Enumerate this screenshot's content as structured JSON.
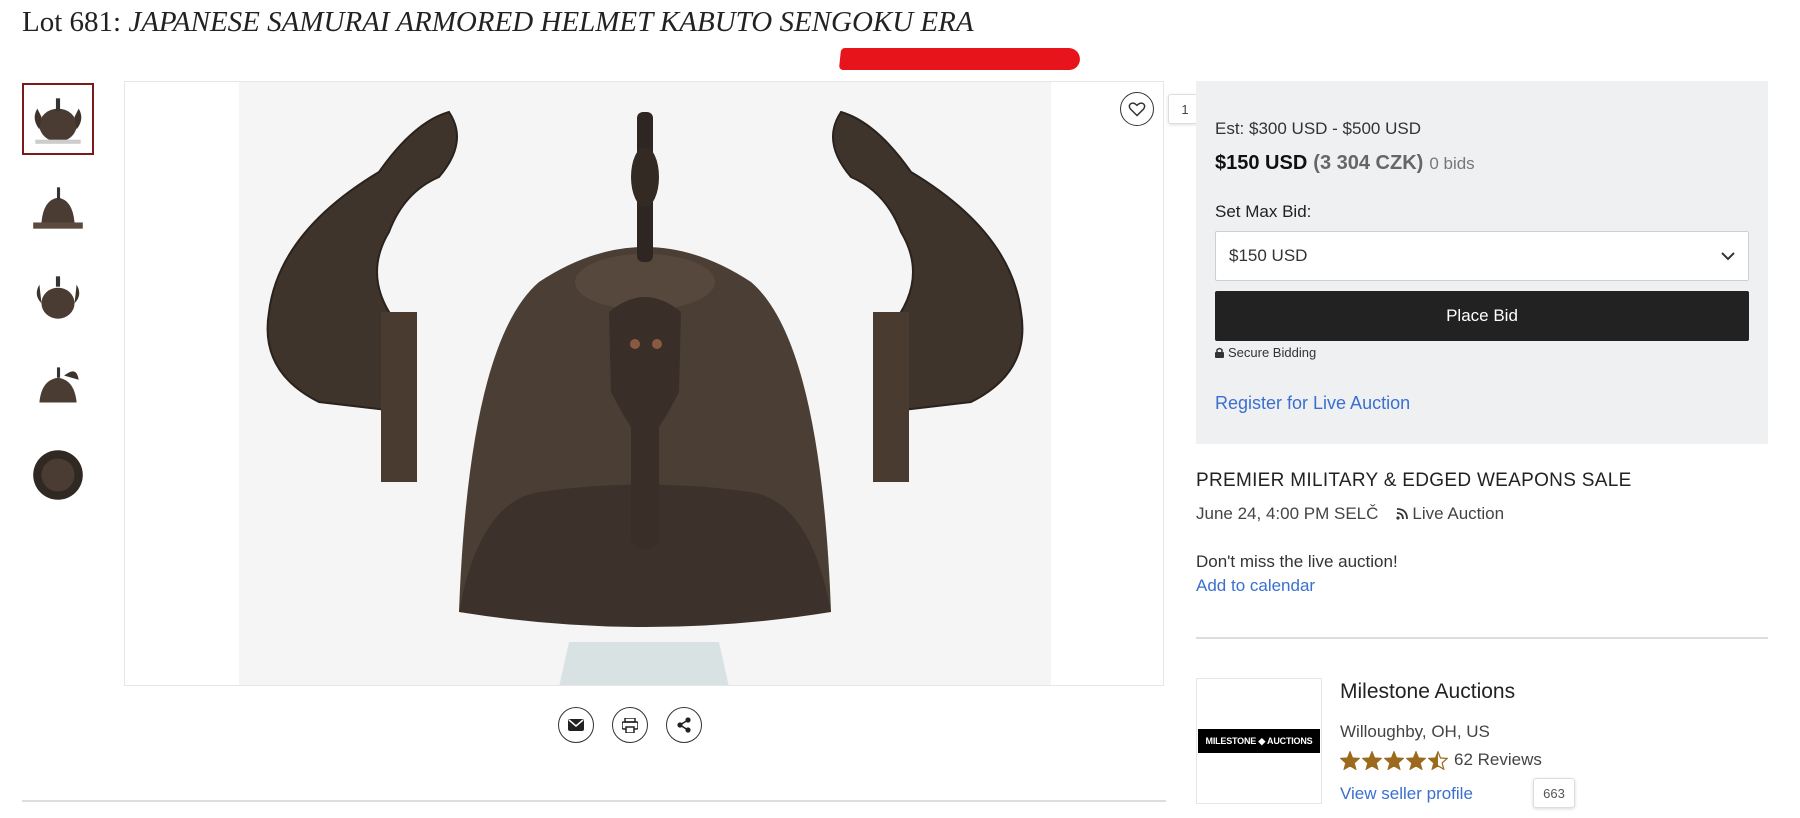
{
  "lot": {
    "prefix": "Lot 681:",
    "title": "JAPANESE SAMURAI ARMORED HELMET KABUTO SENGOKU ERA"
  },
  "thumbnails": [
    {
      "alt": "helmet-front"
    },
    {
      "alt": "helmet-side"
    },
    {
      "alt": "helmet-front-2"
    },
    {
      "alt": "helmet-side-2"
    },
    {
      "alt": "helmet-inside"
    }
  ],
  "favorite": {
    "count": "1"
  },
  "share": {
    "email": "envelope-icon",
    "print": "printer-icon",
    "share": "share-icon"
  },
  "bid": {
    "estimate": "Est: $300 USD - $500 USD",
    "current_usd": "$150 USD",
    "current_czk": "(3 304 CZK)",
    "bids": "0 bids",
    "max_bid_label": "Set Max Bid:",
    "max_bid_value": "$150 USD",
    "place_bid": "Place Bid",
    "secure": "Secure Bidding",
    "register": "Register for Live Auction"
  },
  "sale": {
    "title": "PREMIER MILITARY & EDGED WEAPONS SALE",
    "date": "June 24, 4:00 PM SELČ",
    "type": "Live Auction",
    "reminder": "Don't miss the live auction!",
    "calendar": "Add to calendar"
  },
  "seller": {
    "logo_text": "MILESTONE ◆ AUCTIONS",
    "name": "Milestone Auctions",
    "location": "Willoughby, OH, US",
    "rating": 4.5,
    "reviews": "62 Reviews",
    "profile": "View seller profile",
    "badge": "663"
  },
  "colors": {
    "accent": "#3a6fd0",
    "star": "#9b6a1e",
    "button": "#222222",
    "thumb_active": "#7a1b1b"
  }
}
